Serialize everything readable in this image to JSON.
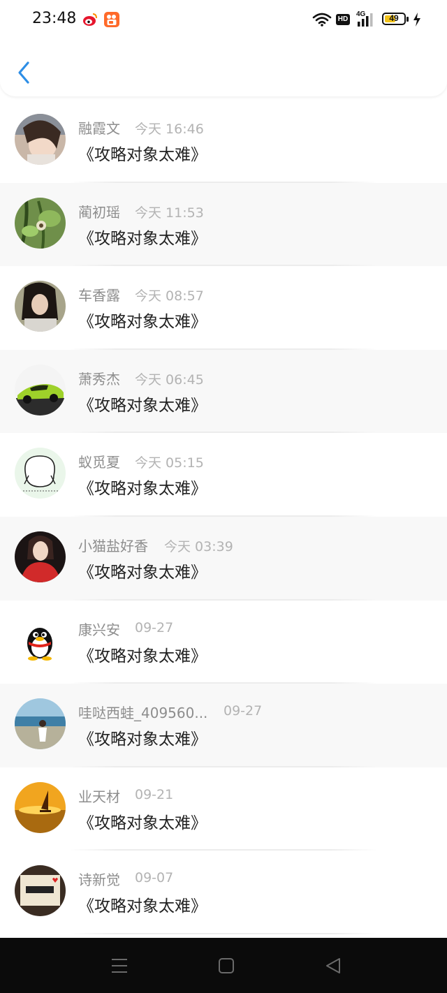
{
  "status_bar": {
    "time": "23:48",
    "battery": "49",
    "battery_percent": 49,
    "hd_label": "HD",
    "network_label": "4G",
    "left_icons": [
      "weibo-icon",
      "kuaishou-icon"
    ],
    "right_icons": [
      "wifi-icon",
      "hd-icon",
      "signal-icon",
      "battery-icon",
      "charging-icon"
    ]
  },
  "header": {
    "back_icon": "chevron-left-icon"
  },
  "accent_color": "#2d8ee6",
  "items": [
    {
      "name": "融霞文",
      "time": "今天 16:46",
      "title": "《攻略对象太难》",
      "avatar": "avatar-girl-portrait"
    },
    {
      "name": "蔺初瑶",
      "time": "今天 11:53",
      "title": "《攻略对象太难》",
      "avatar": "avatar-green-plant"
    },
    {
      "name": "车香露",
      "time": "今天 08:57",
      "title": "《攻略对象太难》",
      "avatar": "avatar-girl-dark-hair"
    },
    {
      "name": "萧秀杰",
      "time": "今天 06:45",
      "title": "《攻略对象太难》",
      "avatar": "avatar-green-car"
    },
    {
      "name": "蚁觅夏",
      "time": "今天 05:15",
      "title": "《攻略对象太难》",
      "avatar": "avatar-cartoon-doodle"
    },
    {
      "name": "小猫盐好香",
      "time": "今天 03:39",
      "title": "《攻略对象太难》",
      "avatar": "avatar-woman-red"
    },
    {
      "name": "康兴安",
      "time": "09-27",
      "title": "《攻略对象太难》",
      "avatar": "avatar-qq-penguin"
    },
    {
      "name": "哇哒西蛙_409560...",
      "time": "09-27",
      "title": "《攻略对象太难》",
      "avatar": "avatar-beach-girl"
    },
    {
      "name": "业天材",
      "time": "09-21",
      "title": "《攻略对象太难》",
      "avatar": "avatar-sunset-sailboat"
    },
    {
      "name": "诗新觉",
      "time": "09-07",
      "title": "《攻略对象太难》",
      "avatar": "avatar-sign-text"
    }
  ],
  "nav": {
    "icons": [
      "menu-icon",
      "home-icon",
      "back-triangle-icon"
    ]
  }
}
